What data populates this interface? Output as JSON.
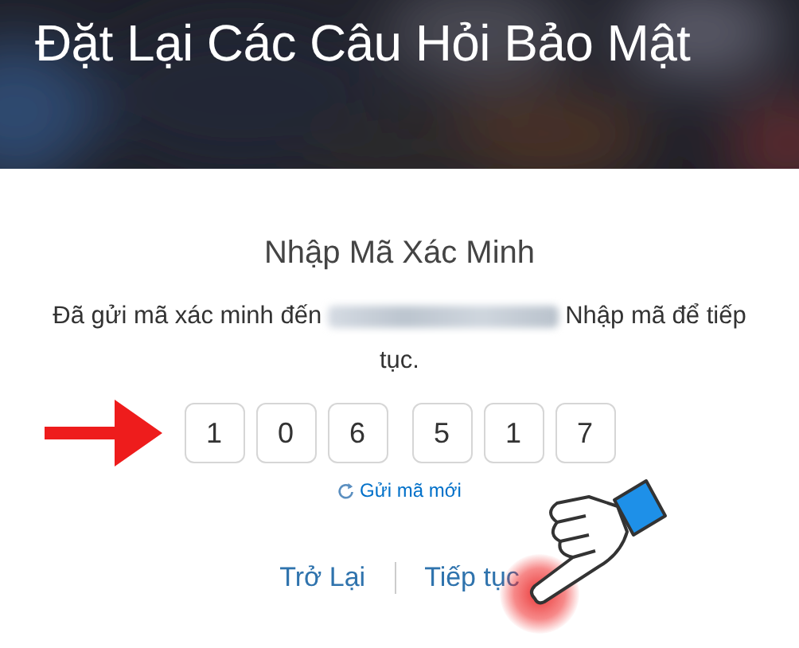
{
  "header": {
    "kind": "picture",
    "title": "Đặt Lại Các Câu Hỏi Bảo Mật"
  },
  "verification": {
    "heading": "Nhập Mã Xác Minh",
    "message_before": "Đã gửi mã xác minh đến",
    "message_after": "Nhập mã để tiếp",
    "message_wrap": "tục.",
    "code_digits": [
      "1",
      "0",
      "6",
      "5",
      "1",
      "7"
    ],
    "resend_link": "Gửi mã mới"
  },
  "footer": {
    "links": [
      {
        "label": "Trở Lại"
      },
      {
        "label": "Tiếp tục"
      }
    ]
  }
}
